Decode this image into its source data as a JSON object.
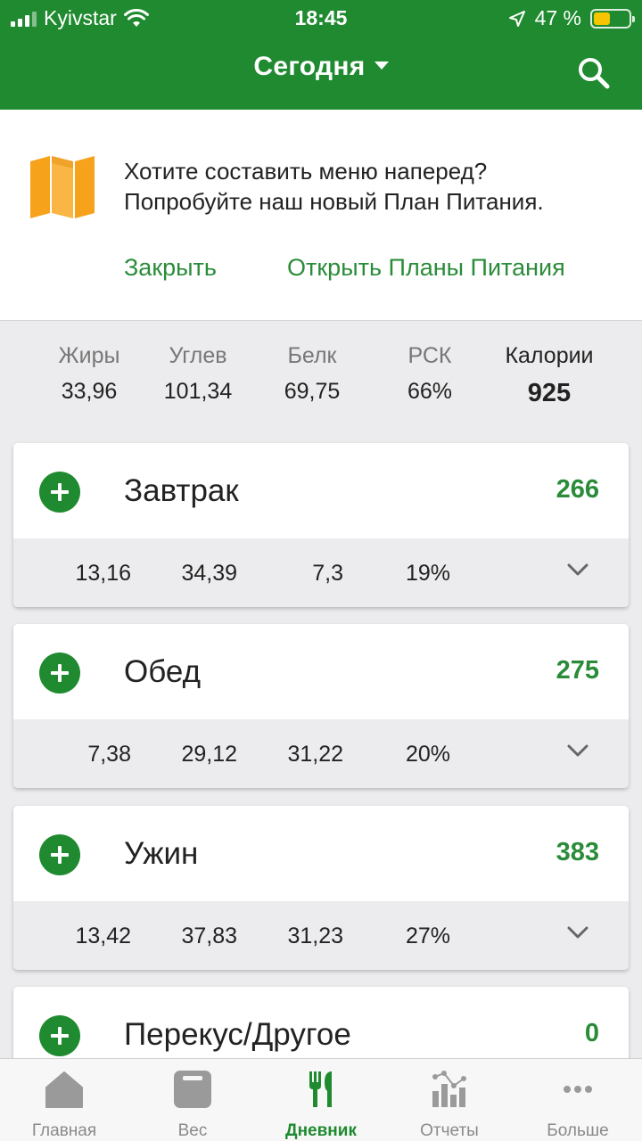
{
  "status_bar": {
    "carrier": "Kyivstar",
    "time": "18:45",
    "battery_text": "47 %",
    "battery_level": 0.47,
    "battery_color": "#f6c400"
  },
  "nav": {
    "title": "Сегодня",
    "search_icon": "search-icon"
  },
  "promo": {
    "icon": "map-icon",
    "message_line1": "Хотите составить меню наперед?",
    "message_line2": "Попробуйте наш новый План Питания.",
    "close_label": "Закрыть",
    "open_label": "Открыть Планы Питания"
  },
  "summary": {
    "columns": [
      {
        "label": "Жиры",
        "value": "33,96"
      },
      {
        "label": "Углев",
        "value": "101,34"
      },
      {
        "label": "Белк",
        "value": "69,75"
      },
      {
        "label": "РСК",
        "value": "66%"
      },
      {
        "label": "Калории",
        "value": "925"
      }
    ]
  },
  "meals": [
    {
      "name": "Завтрак",
      "calories": "266",
      "macros": [
        "13,16",
        "34,39",
        "7,3",
        "19%"
      ]
    },
    {
      "name": "Обед",
      "calories": "275",
      "macros": [
        "7,38",
        "29,12",
        "31,22",
        "20%"
      ]
    },
    {
      "name": "Ужин",
      "calories": "383",
      "macros": [
        "13,42",
        "37,83",
        "31,23",
        "27%"
      ]
    },
    {
      "name": "Перекус/Другое",
      "calories": "0"
    }
  ],
  "tabs": [
    {
      "label": "Главная",
      "icon": "home-icon"
    },
    {
      "label": "Вес",
      "icon": "scale-icon"
    },
    {
      "label": "Дневник",
      "icon": "fork-knife-icon",
      "active": true
    },
    {
      "label": "Отчеты",
      "icon": "chart-icon"
    },
    {
      "label": "Больше",
      "icon": "more-icon"
    }
  ],
  "colors": {
    "brand_green": "#1f8a2f",
    "link_green": "#2a8c39",
    "accent_orange": "#f7a21b"
  }
}
